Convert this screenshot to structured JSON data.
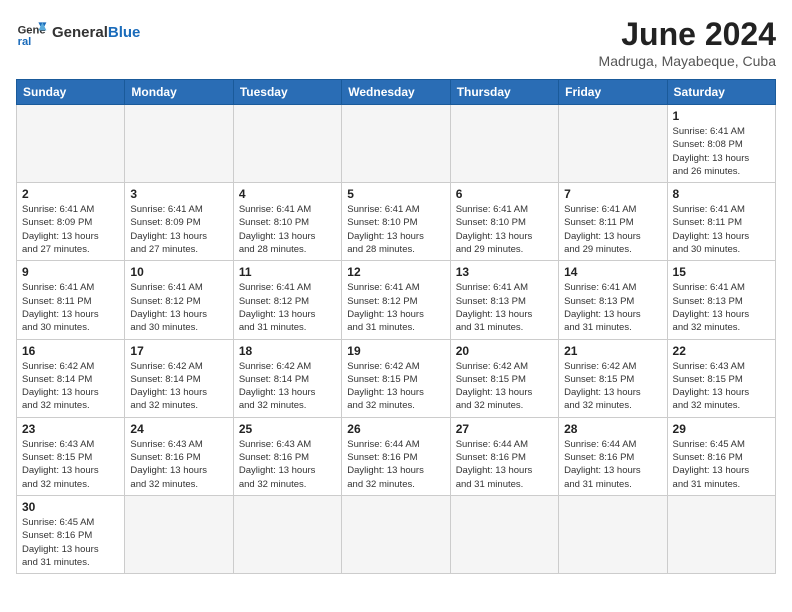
{
  "header": {
    "logo_general": "General",
    "logo_blue": "Blue",
    "month_title": "June 2024",
    "location": "Madruga, Mayabeque, Cuba"
  },
  "weekdays": [
    "Sunday",
    "Monday",
    "Tuesday",
    "Wednesday",
    "Thursday",
    "Friday",
    "Saturday"
  ],
  "days": [
    {
      "num": "",
      "info": "",
      "empty": true
    },
    {
      "num": "",
      "info": "",
      "empty": true
    },
    {
      "num": "",
      "info": "",
      "empty": true
    },
    {
      "num": "",
      "info": "",
      "empty": true
    },
    {
      "num": "",
      "info": "",
      "empty": true
    },
    {
      "num": "",
      "info": "",
      "empty": true
    },
    {
      "num": "1",
      "info": "Sunrise: 6:41 AM\nSunset: 8:08 PM\nDaylight: 13 hours\nand 26 minutes.",
      "empty": false
    },
    {
      "num": "2",
      "info": "Sunrise: 6:41 AM\nSunset: 8:09 PM\nDaylight: 13 hours\nand 27 minutes.",
      "empty": false
    },
    {
      "num": "3",
      "info": "Sunrise: 6:41 AM\nSunset: 8:09 PM\nDaylight: 13 hours\nand 27 minutes.",
      "empty": false
    },
    {
      "num": "4",
      "info": "Sunrise: 6:41 AM\nSunset: 8:10 PM\nDaylight: 13 hours\nand 28 minutes.",
      "empty": false
    },
    {
      "num": "5",
      "info": "Sunrise: 6:41 AM\nSunset: 8:10 PM\nDaylight: 13 hours\nand 28 minutes.",
      "empty": false
    },
    {
      "num": "6",
      "info": "Sunrise: 6:41 AM\nSunset: 8:10 PM\nDaylight: 13 hours\nand 29 minutes.",
      "empty": false
    },
    {
      "num": "7",
      "info": "Sunrise: 6:41 AM\nSunset: 8:11 PM\nDaylight: 13 hours\nand 29 minutes.",
      "empty": false
    },
    {
      "num": "8",
      "info": "Sunrise: 6:41 AM\nSunset: 8:11 PM\nDaylight: 13 hours\nand 30 minutes.",
      "empty": false
    },
    {
      "num": "9",
      "info": "Sunrise: 6:41 AM\nSunset: 8:11 PM\nDaylight: 13 hours\nand 30 minutes.",
      "empty": false
    },
    {
      "num": "10",
      "info": "Sunrise: 6:41 AM\nSunset: 8:12 PM\nDaylight: 13 hours\nand 30 minutes.",
      "empty": false
    },
    {
      "num": "11",
      "info": "Sunrise: 6:41 AM\nSunset: 8:12 PM\nDaylight: 13 hours\nand 31 minutes.",
      "empty": false
    },
    {
      "num": "12",
      "info": "Sunrise: 6:41 AM\nSunset: 8:12 PM\nDaylight: 13 hours\nand 31 minutes.",
      "empty": false
    },
    {
      "num": "13",
      "info": "Sunrise: 6:41 AM\nSunset: 8:13 PM\nDaylight: 13 hours\nand 31 minutes.",
      "empty": false
    },
    {
      "num": "14",
      "info": "Sunrise: 6:41 AM\nSunset: 8:13 PM\nDaylight: 13 hours\nand 31 minutes.",
      "empty": false
    },
    {
      "num": "15",
      "info": "Sunrise: 6:41 AM\nSunset: 8:13 PM\nDaylight: 13 hours\nand 32 minutes.",
      "empty": false
    },
    {
      "num": "16",
      "info": "Sunrise: 6:42 AM\nSunset: 8:14 PM\nDaylight: 13 hours\nand 32 minutes.",
      "empty": false
    },
    {
      "num": "17",
      "info": "Sunrise: 6:42 AM\nSunset: 8:14 PM\nDaylight: 13 hours\nand 32 minutes.",
      "empty": false
    },
    {
      "num": "18",
      "info": "Sunrise: 6:42 AM\nSunset: 8:14 PM\nDaylight: 13 hours\nand 32 minutes.",
      "empty": false
    },
    {
      "num": "19",
      "info": "Sunrise: 6:42 AM\nSunset: 8:15 PM\nDaylight: 13 hours\nand 32 minutes.",
      "empty": false
    },
    {
      "num": "20",
      "info": "Sunrise: 6:42 AM\nSunset: 8:15 PM\nDaylight: 13 hours\nand 32 minutes.",
      "empty": false
    },
    {
      "num": "21",
      "info": "Sunrise: 6:42 AM\nSunset: 8:15 PM\nDaylight: 13 hours\nand 32 minutes.",
      "empty": false
    },
    {
      "num": "22",
      "info": "Sunrise: 6:43 AM\nSunset: 8:15 PM\nDaylight: 13 hours\nand 32 minutes.",
      "empty": false
    },
    {
      "num": "23",
      "info": "Sunrise: 6:43 AM\nSunset: 8:15 PM\nDaylight: 13 hours\nand 32 minutes.",
      "empty": false
    },
    {
      "num": "24",
      "info": "Sunrise: 6:43 AM\nSunset: 8:16 PM\nDaylight: 13 hours\nand 32 minutes.",
      "empty": false
    },
    {
      "num": "25",
      "info": "Sunrise: 6:43 AM\nSunset: 8:16 PM\nDaylight: 13 hours\nand 32 minutes.",
      "empty": false
    },
    {
      "num": "26",
      "info": "Sunrise: 6:44 AM\nSunset: 8:16 PM\nDaylight: 13 hours\nand 32 minutes.",
      "empty": false
    },
    {
      "num": "27",
      "info": "Sunrise: 6:44 AM\nSunset: 8:16 PM\nDaylight: 13 hours\nand 31 minutes.",
      "empty": false
    },
    {
      "num": "28",
      "info": "Sunrise: 6:44 AM\nSunset: 8:16 PM\nDaylight: 13 hours\nand 31 minutes.",
      "empty": false
    },
    {
      "num": "29",
      "info": "Sunrise: 6:45 AM\nSunset: 8:16 PM\nDaylight: 13 hours\nand 31 minutes.",
      "empty": false
    },
    {
      "num": "30",
      "info": "Sunrise: 6:45 AM\nSunset: 8:16 PM\nDaylight: 13 hours\nand 31 minutes.",
      "empty": false
    },
    {
      "num": "",
      "info": "",
      "empty": true
    },
    {
      "num": "",
      "info": "",
      "empty": true
    },
    {
      "num": "",
      "info": "",
      "empty": true
    },
    {
      "num": "",
      "info": "",
      "empty": true
    },
    {
      "num": "",
      "info": "",
      "empty": true
    },
    {
      "num": "",
      "info": "",
      "empty": true
    }
  ]
}
